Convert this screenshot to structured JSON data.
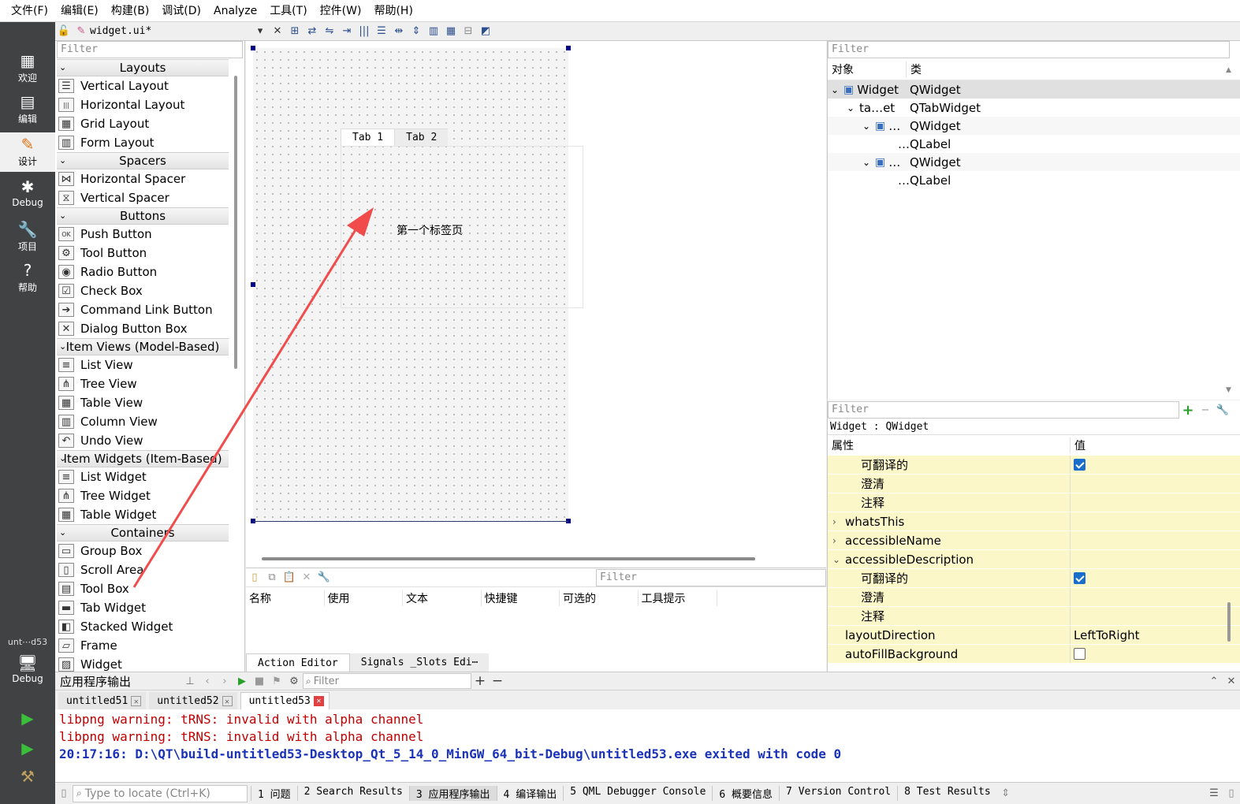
{
  "menu": [
    "文件(F)",
    "编辑(E)",
    "构建(B)",
    "调试(D)",
    "Analyze",
    "工具(T)",
    "控件(W)",
    "帮助(H)"
  ],
  "modes": [
    {
      "label": "欢迎",
      "icon": "grid-icon",
      "glyph": "▦"
    },
    {
      "label": "编辑",
      "icon": "edit-doc-icon",
      "glyph": "▤"
    },
    {
      "label": "设计",
      "icon": "pencil-icon",
      "glyph": "✎"
    },
    {
      "label": "Debug",
      "icon": "bug-icon",
      "glyph": "✱"
    },
    {
      "label": "项目",
      "icon": "wrench-icon",
      "glyph": "🔧"
    },
    {
      "label": "帮助",
      "icon": "help-icon",
      "glyph": "?"
    }
  ],
  "kit": {
    "project": "unt⋯d53",
    "label": "Debug"
  },
  "doc": {
    "filename": "widget.ui*"
  },
  "widgetbox": {
    "filter_placeholder": "Filter",
    "categories": [
      {
        "name": "Layouts",
        "items": [
          {
            "label": "Vertical Layout",
            "glyph": "☰"
          },
          {
            "label": "Horizontal Layout",
            "glyph": "|||"
          },
          {
            "label": "Grid Layout",
            "glyph": "▦"
          },
          {
            "label": "Form Layout",
            "glyph": "▥"
          }
        ]
      },
      {
        "name": "Spacers",
        "items": [
          {
            "label": "Horizontal Spacer",
            "glyph": "⋈"
          },
          {
            "label": "Vertical Spacer",
            "glyph": "⧖"
          }
        ]
      },
      {
        "name": "Buttons",
        "items": [
          {
            "label": "Push Button",
            "glyph": "OK"
          },
          {
            "label": "Tool Button",
            "glyph": "⚙"
          },
          {
            "label": "Radio Button",
            "glyph": "◉"
          },
          {
            "label": "Check Box",
            "glyph": "☑"
          },
          {
            "label": "Command Link Button",
            "glyph": "➔"
          },
          {
            "label": "Dialog Button Box",
            "glyph": "✕"
          }
        ]
      },
      {
        "name": "Item Views (Model-Based)",
        "items": [
          {
            "label": "List View",
            "glyph": "≡"
          },
          {
            "label": "Tree View",
            "glyph": "⋔"
          },
          {
            "label": "Table View",
            "glyph": "▦"
          },
          {
            "label": "Column View",
            "glyph": "▥"
          },
          {
            "label": "Undo View",
            "glyph": "↶"
          }
        ]
      },
      {
        "name": "Item Widgets (Item-Based)",
        "items": [
          {
            "label": "List Widget",
            "glyph": "≡"
          },
          {
            "label": "Tree Widget",
            "glyph": "⋔"
          },
          {
            "label": "Table Widget",
            "glyph": "▦"
          }
        ]
      },
      {
        "name": "Containers",
        "items": [
          {
            "label": "Group Box",
            "glyph": "▭"
          },
          {
            "label": "Scroll Area",
            "glyph": "▯"
          },
          {
            "label": "Tool Box",
            "glyph": "▤"
          },
          {
            "label": "Tab Widget",
            "glyph": "▬"
          },
          {
            "label": "Stacked Widget",
            "glyph": "◧"
          },
          {
            "label": "Frame",
            "glyph": "▱"
          },
          {
            "label": "Widget",
            "glyph": "▨"
          }
        ]
      }
    ]
  },
  "form": {
    "tabs": [
      "Tab 1",
      "Tab 2"
    ],
    "label": "第一个标签页"
  },
  "objinspector": {
    "filter_placeholder": "Filter",
    "headers": [
      "对象",
      "类"
    ],
    "rows": [
      {
        "name": "Widget",
        "cls": "QWidget",
        "indent": 0,
        "exp": "⌄"
      },
      {
        "name": "ta…et",
        "cls": "QTabWidget",
        "indent": 1,
        "exp": "⌄"
      },
      {
        "name": "…",
        "cls": "QWidget",
        "indent": 2,
        "exp": "⌄"
      },
      {
        "name": "…",
        "cls": "QLabel",
        "indent": 3,
        "exp": ""
      },
      {
        "name": "…",
        "cls": "QWidget",
        "indent": 2,
        "exp": "⌄"
      },
      {
        "name": "…",
        "cls": "QLabel",
        "indent": 3,
        "exp": ""
      }
    ]
  },
  "propeditor": {
    "filter_placeholder": "Filter",
    "context": "Widget : QWidget",
    "headers": [
      "属性",
      "值"
    ],
    "rows": [
      {
        "name": "可翻译的",
        "value": "",
        "check": "on",
        "indent": 2,
        "exp": ""
      },
      {
        "name": "澄清",
        "value": "",
        "check": "",
        "indent": 2,
        "exp": ""
      },
      {
        "name": "注释",
        "value": "",
        "check": "",
        "indent": 2,
        "exp": ""
      },
      {
        "name": "whatsThis",
        "value": "",
        "check": "",
        "indent": 1,
        "exp": "›"
      },
      {
        "name": "accessibleName",
        "value": "",
        "check": "",
        "indent": 1,
        "exp": "›"
      },
      {
        "name": "accessibleDescription",
        "value": "",
        "check": "",
        "indent": 1,
        "exp": "⌄"
      },
      {
        "name": "可翻译的",
        "value": "",
        "check": "on",
        "indent": 2,
        "exp": ""
      },
      {
        "name": "澄清",
        "value": "",
        "check": "",
        "indent": 2,
        "exp": ""
      },
      {
        "name": "注释",
        "value": "",
        "check": "",
        "indent": 2,
        "exp": ""
      },
      {
        "name": "layoutDirection",
        "value": "LeftToRight",
        "check": "",
        "indent": 1,
        "exp": ""
      },
      {
        "name": "autoFillBackground",
        "value": "",
        "check": "off",
        "indent": 1,
        "exp": ""
      }
    ]
  },
  "actioneditor": {
    "filter_placeholder": "Filter",
    "columns": [
      "名称",
      "使用",
      "文本",
      "快捷键",
      "可选的",
      "工具提示"
    ],
    "tabs": [
      "Action Editor",
      "Signals _Slots Edi⋯"
    ]
  },
  "output": {
    "title": "应用程序输出",
    "filter_placeholder": "Filter",
    "tabs": [
      "untitled51",
      "untitled52",
      "untitled53"
    ],
    "lines": [
      {
        "text": "libpng warning: tRNS: invalid with alpha channel",
        "color": "#c00000",
        "bold": false
      },
      {
        "text": "libpng warning: tRNS: invalid with alpha channel",
        "color": "#c00000",
        "bold": false
      },
      {
        "text": "20:17:16: D:\\QT\\build-untitled53-Desktop_Qt_5_14_0_MinGW_64_bit-Debug\\untitled53.exe exited with code 0",
        "color": "#1a33b8",
        "bold": true
      }
    ]
  },
  "status": {
    "locator_placeholder": "Type to locate (Ctrl+K)",
    "panes": [
      "1 问题",
      "2 Search Results",
      "3 应用程序输出",
      "4 编译输出",
      "5 QML Debugger Console",
      "6 概要信息",
      "7 Version Control",
      "8 Test Results"
    ]
  },
  "colors": {
    "arrow": "#f24b4b",
    "selection": "#000080",
    "prop_bg": "#fbf7c8"
  }
}
